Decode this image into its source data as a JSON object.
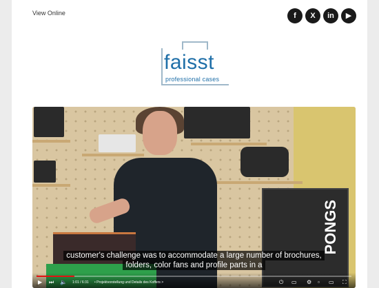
{
  "header": {
    "view_online": "View Online"
  },
  "social": [
    "f",
    "X",
    "in",
    "▶"
  ],
  "logo": {
    "name": "faisst",
    "tagline": "professional cases"
  },
  "video": {
    "subtitle_line1": "customer's challenge was to accommodate a large number of brochures,",
    "subtitle_line2": "folders, color fans and profile parts in a",
    "time": "1:01 / 6:31",
    "chapter": "• Projektvorstellung und Details des Koffers  >",
    "progress": 0.12,
    "brand_on_case": "PONGS"
  }
}
